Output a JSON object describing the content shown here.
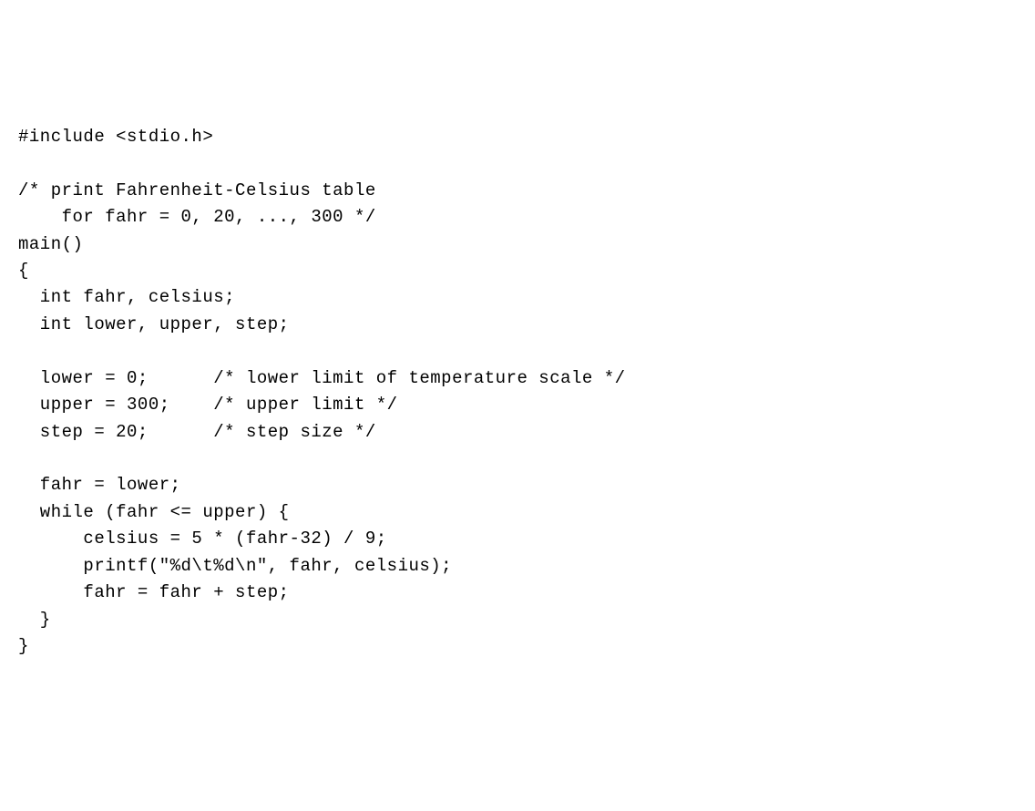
{
  "code": {
    "lines": [
      "#include <stdio.h>",
      "",
      "/* print Fahrenheit-Celsius table",
      "    for fahr = 0, 20, ..., 300 */",
      "main()",
      "{",
      "  int fahr, celsius;",
      "  int lower, upper, step;",
      "",
      "  lower = 0;      /* lower limit of temperature scale */",
      "  upper = 300;    /* upper limit */",
      "  step = 20;      /* step size */",
      "",
      "  fahr = lower;",
      "  while (fahr <= upper) {",
      "      celsius = 5 * (fahr-32) / 9;",
      "      printf(\"%d\\t%d\\n\", fahr, celsius);",
      "      fahr = fahr + step;",
      "  }",
      "}"
    ]
  }
}
